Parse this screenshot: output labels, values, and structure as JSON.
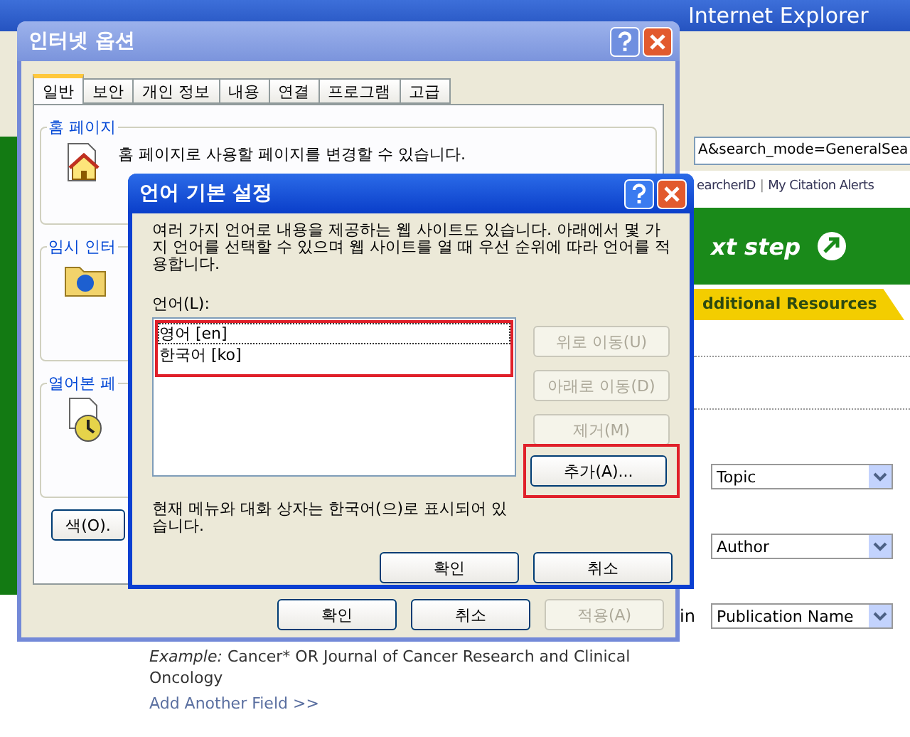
{
  "browser": {
    "title": "Internet Explorer",
    "address": "A&search_mode=GeneralSea",
    "links": [
      {
        "label": "earcherID"
      },
      {
        "label": "My Citation Alerts"
      }
    ],
    "link_separator": "|",
    "banner": "xt step",
    "resources_tab": "dditional Resources",
    "fields": [
      {
        "value": "Topic"
      },
      {
        "value": "Author"
      },
      {
        "value": "Publication Name",
        "prefix": "in"
      }
    ],
    "example": {
      "label": "Example:",
      "text": "Cancer* OR Journal of Cancer Research and Clinical Oncology"
    },
    "add_field": "Add Another Field >>"
  },
  "internet_options": {
    "title": "인터넷 옵션",
    "active": false,
    "tabs": [
      {
        "label": "일반",
        "selected": true
      },
      {
        "label": "보안",
        "selected": false
      },
      {
        "label": "개인 정보",
        "selected": false
      },
      {
        "label": "내용",
        "selected": false
      },
      {
        "label": "연결",
        "selected": false
      },
      {
        "label": "프로그램",
        "selected": false
      },
      {
        "label": "고급",
        "selected": false
      }
    ],
    "groups": [
      {
        "legend": "홈 페이지",
        "text": "홈 페이지로 사용할 페이지를 변경할 수 있습니다."
      },
      {
        "legend": "임시 인터"
      },
      {
        "legend": "열어본 페"
      }
    ],
    "color_button": "색(O).",
    "buttons": [
      {
        "label": "확인",
        "disabled": false
      },
      {
        "label": "취소",
        "disabled": false
      },
      {
        "label": "적용(A)",
        "disabled": true
      }
    ]
  },
  "language_dialog": {
    "title": "언어 기본 설정",
    "active": true,
    "description": "여러 가지 언어로 내용을 제공하는 웹 사이트도 있습니다. 아래에서 몇 가지 언어를 선택할 수 있으며 웹 사이트를 열 때 우선 순위에 따라 언어를 적용합니다.",
    "list_label": "언어(L):",
    "languages": [
      {
        "label": "영어 [en]",
        "focused": true
      },
      {
        "label": "한국어 [ko]",
        "focused": false
      }
    ],
    "side_buttons": [
      {
        "label": "위로 이동(U)",
        "disabled": true,
        "highlighted": false
      },
      {
        "label": "아래로 이동(D)",
        "disabled": true,
        "highlighted": false
      },
      {
        "label": "제거(M)",
        "disabled": true,
        "highlighted": false
      },
      {
        "label": "추가(A)...",
        "disabled": false,
        "highlighted": true
      }
    ],
    "note": "현재 메뉴와 대화 상자는 한국어(으)로 표시되어 있습니다.",
    "buttons": [
      {
        "label": "확인",
        "disabled": false
      },
      {
        "label": "취소",
        "disabled": false
      }
    ]
  }
}
